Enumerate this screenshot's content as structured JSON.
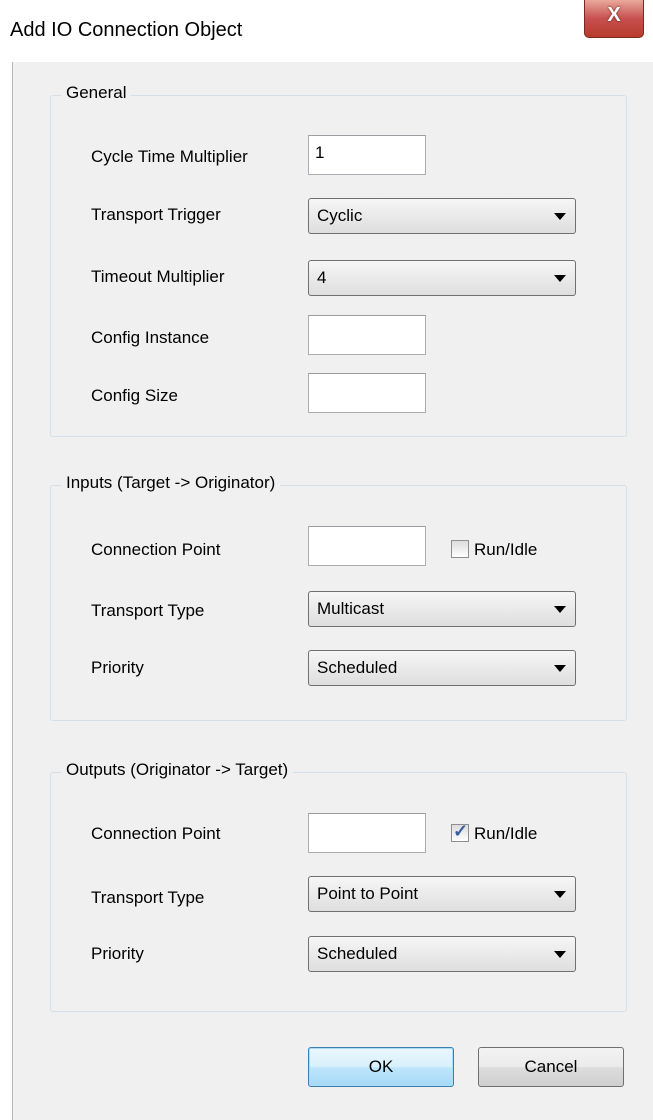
{
  "window": {
    "title": "Add IO Connection Object",
    "close_glyph": "X"
  },
  "general": {
    "title": "General",
    "cycle_time_multiplier": {
      "label": "Cycle Time Multiplier",
      "value": "1"
    },
    "transport_trigger": {
      "label": "Transport Trigger",
      "value": "Cyclic"
    },
    "timeout_multiplier": {
      "label": "Timeout Multiplier",
      "value": "4"
    },
    "config_instance": {
      "label": "Config Instance",
      "value": ""
    },
    "config_size": {
      "label": "Config Size",
      "value": ""
    }
  },
  "inputs": {
    "title": "Inputs (Target -> Originator)",
    "connection_point": {
      "label": "Connection Point",
      "value": ""
    },
    "run_idle": {
      "label": "Run/Idle",
      "checked": false
    },
    "transport_type": {
      "label": "Transport Type",
      "value": "Multicast"
    },
    "priority": {
      "label": "Priority",
      "value": "Scheduled"
    }
  },
  "outputs": {
    "title": "Outputs (Originator -> Target)",
    "connection_point": {
      "label": "Connection Point",
      "value": ""
    },
    "run_idle": {
      "label": "Run/Idle",
      "checked": true
    },
    "transport_type": {
      "label": "Transport Type",
      "value": "Point to Point"
    },
    "priority": {
      "label": "Priority",
      "value": "Scheduled"
    }
  },
  "buttons": {
    "ok": "OK",
    "cancel": "Cancel"
  }
}
